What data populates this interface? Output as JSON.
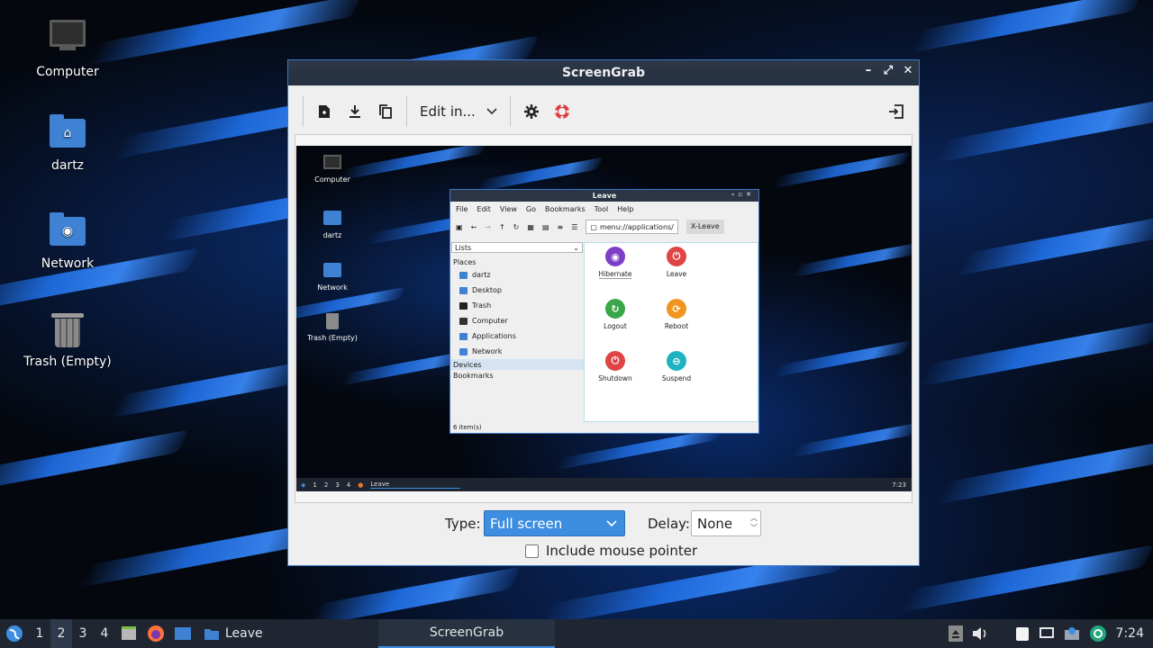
{
  "desktop": {
    "icons": [
      {
        "label": "Computer",
        "icon": "computer-icon"
      },
      {
        "label": "dartz",
        "icon": "home-folder-icon"
      },
      {
        "label": "Network",
        "icon": "network-folder-icon"
      },
      {
        "label": "Trash (Empty)",
        "icon": "trash-icon"
      }
    ]
  },
  "window": {
    "title": "ScreenGrab",
    "controls": {
      "minimize": "–",
      "maximize": "⤢",
      "close": "✕"
    },
    "toolbar": {
      "edit_label": "Edit in...",
      "icons": [
        "new-screenshot-icon",
        "save-icon",
        "copy-icon",
        "chevron-down-icon",
        "settings-gear-icon",
        "help-lifebuoy-icon",
        "exit-icon"
      ]
    },
    "preview": {
      "desktop_icons": [
        "Computer",
        "dartz",
        "Network",
        "Trash (Empty)"
      ],
      "leave_window": {
        "title": "Leave",
        "menu": [
          "File",
          "Edit",
          "View",
          "Go",
          "Bookmarks",
          "Tool",
          "Help"
        ],
        "address": "menu://applications/",
        "tab": "X-Leave",
        "sidebar_dropdown": "Lists",
        "places_header": "Places",
        "places": [
          "dartz",
          "Desktop",
          "Trash",
          "Computer",
          "Applications",
          "Network"
        ],
        "devices": "Devices",
        "bookmarks": "Bookmarks",
        "apps": [
          {
            "label": "Hibernate",
            "color": "#7e3fc7"
          },
          {
            "label": "Leave",
            "color": "#e04545"
          },
          {
            "label": "Logout",
            "color": "#3aa84a"
          },
          {
            "label": "Reboot",
            "color": "#f0951f"
          },
          {
            "label": "Shutdown",
            "color": "#e04545"
          },
          {
            "label": "Suspend",
            "color": "#1fb3c2"
          }
        ],
        "status": "6 item(s)"
      },
      "taskbar": {
        "workspaces": [
          "1",
          "2",
          "3",
          "4"
        ],
        "task": "Leave",
        "clock": "7:23"
      }
    },
    "type_label": "Type:",
    "type_value": "Full screen",
    "delay_label": "Delay:",
    "delay_value": "None",
    "mouse_label": "Include mouse pointer",
    "mouse_checked": false
  },
  "taskbar": {
    "workspaces": [
      "1",
      "2",
      "3",
      "4"
    ],
    "active_workspace": "2",
    "tasks": [
      {
        "label": "Leave",
        "icon": "folder-icon"
      },
      {
        "label": "ScreenGrab",
        "icon": ""
      }
    ],
    "clock": "7:24",
    "accent": "#3d8ee0"
  }
}
